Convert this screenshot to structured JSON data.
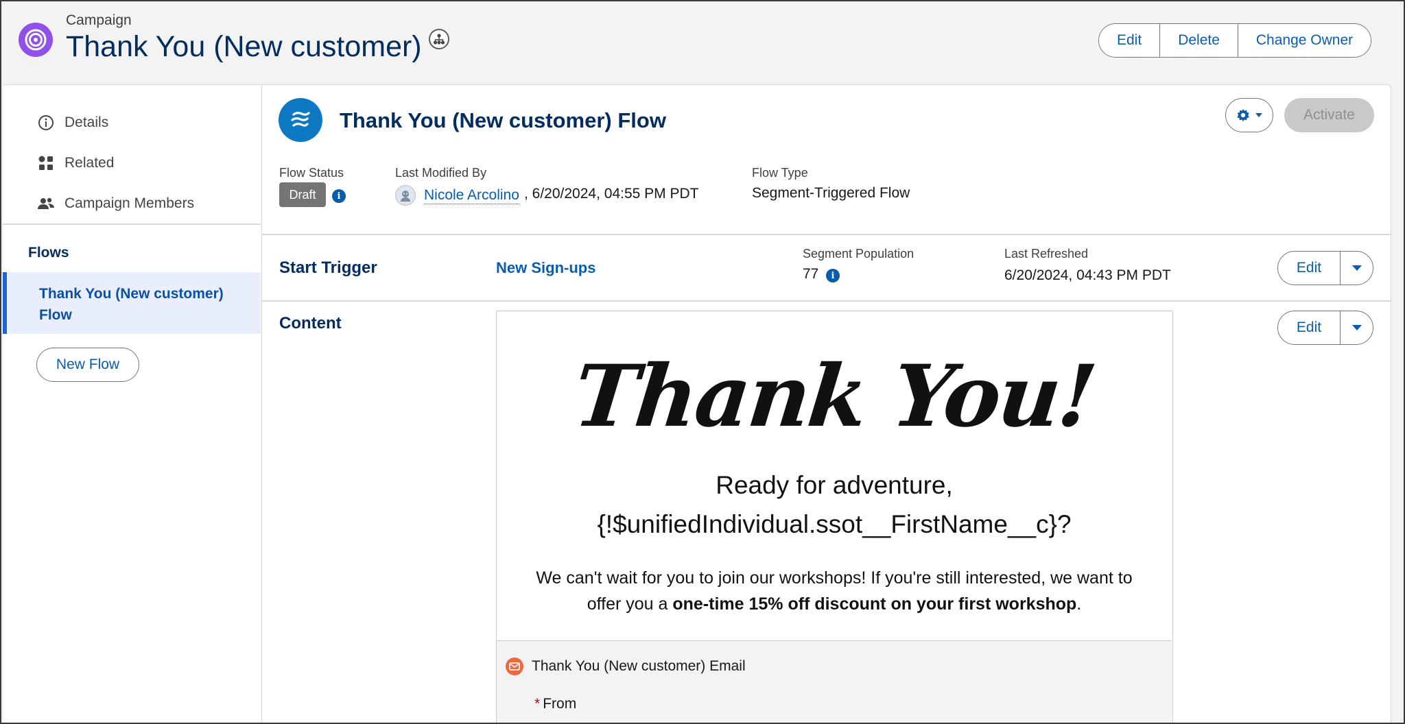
{
  "header": {
    "object_type": "Campaign",
    "title": "Thank You (New customer)",
    "actions": [
      "Edit",
      "Delete",
      "Change Owner"
    ]
  },
  "sidebar": {
    "items": [
      {
        "label": "Details",
        "icon": "info-icon"
      },
      {
        "label": "Related",
        "icon": "related-icon"
      },
      {
        "label": "Campaign Members",
        "icon": "people-icon"
      }
    ],
    "flows_heading": "Flows",
    "active_flow": "Thank You (New customer) Flow",
    "new_flow_label": "New Flow"
  },
  "flow": {
    "title": "Thank You (New customer) Flow",
    "activate_label": "Activate",
    "status_label": "Flow Status",
    "status_value": "Draft",
    "modified_label": "Last Modified By",
    "modified_user": "Nicole Arcolino",
    "modified_date": ", 6/20/2024, 04:55 PM PDT",
    "type_label": "Flow Type",
    "type_value": "Segment-Triggered Flow"
  },
  "start_trigger": {
    "label": "Start Trigger",
    "segment": "New Sign-ups",
    "population_label": "Segment Population",
    "population_value": "77",
    "refreshed_label": "Last Refreshed",
    "refreshed_value": "6/20/2024, 04:43 PM PDT",
    "edit_label": "Edit"
  },
  "content": {
    "label": "Content",
    "edit_label": "Edit",
    "preview": {
      "headline": "Thank You!",
      "ready_line1": "Ready for adventure,",
      "ready_line2": "{!$unifiedIndividual.ssot__FirstName__c}?",
      "body_text": "We can't wait for you to join our workshops! If you're still interested, we want to offer you a ",
      "body_bold": "one-time 15% off discount on your first workshop",
      "body_end": "."
    },
    "email_name": "Thank You (New customer) Email",
    "from_label": "From",
    "from_required_mark": "*"
  },
  "colors": {
    "campaign_icon": "#9050e9",
    "flow_icon": "#0d79c2",
    "brand_blue": "#0b5cab",
    "title_navy": "#032d60",
    "email_icon": "#f0683e"
  }
}
